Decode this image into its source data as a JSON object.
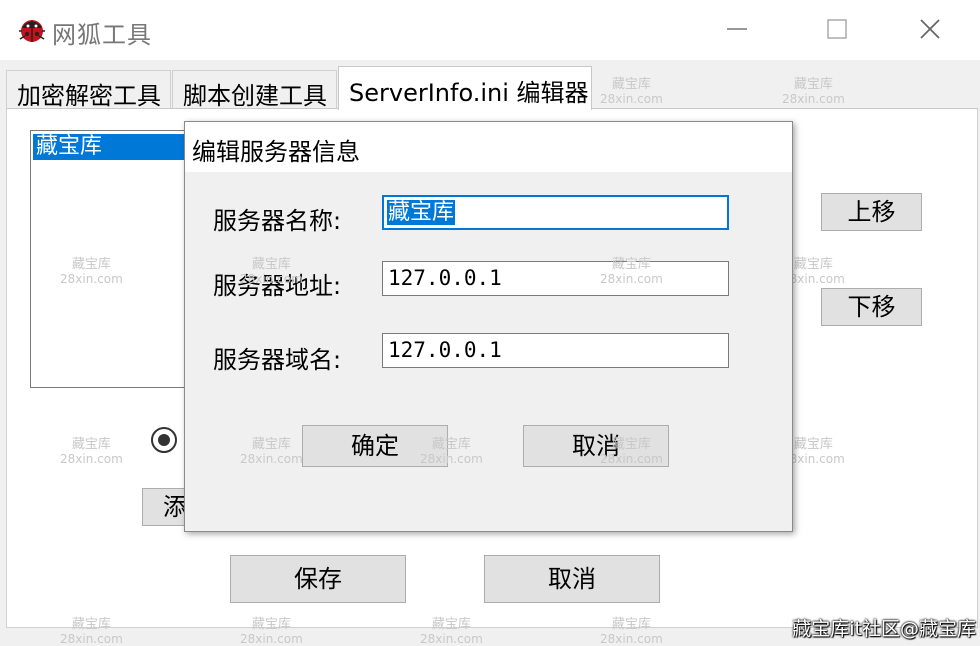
{
  "window": {
    "title": "网狐工具"
  },
  "tabs": [
    {
      "label": "加密解密工具"
    },
    {
      "label": "脚本创建工具"
    },
    {
      "label": "ServerInfo.ini 编辑器"
    }
  ],
  "main": {
    "list_items": [
      "藏宝库"
    ],
    "move_up_label": "上移",
    "move_down_label": "下移",
    "add_label": "添",
    "save_label": "保存",
    "cancel_label": "取消"
  },
  "dialog": {
    "title": "编辑服务器信息",
    "name_label": "服务器名称:",
    "address_label": "服务器地址:",
    "domain_label": "服务器域名:",
    "name_value": "藏宝库",
    "address_value": "127.0.0.1",
    "domain_value": "127.0.0.1",
    "ok_label": "确定",
    "cancel_label": "取消"
  },
  "watermark": {
    "line1": "藏宝库",
    "line2": "28xin.com"
  },
  "footer_watermark": "藏宝库it社区@藏宝库",
  "colors": {
    "selection": "#0078d7",
    "button_face": "#e1e1e1"
  }
}
